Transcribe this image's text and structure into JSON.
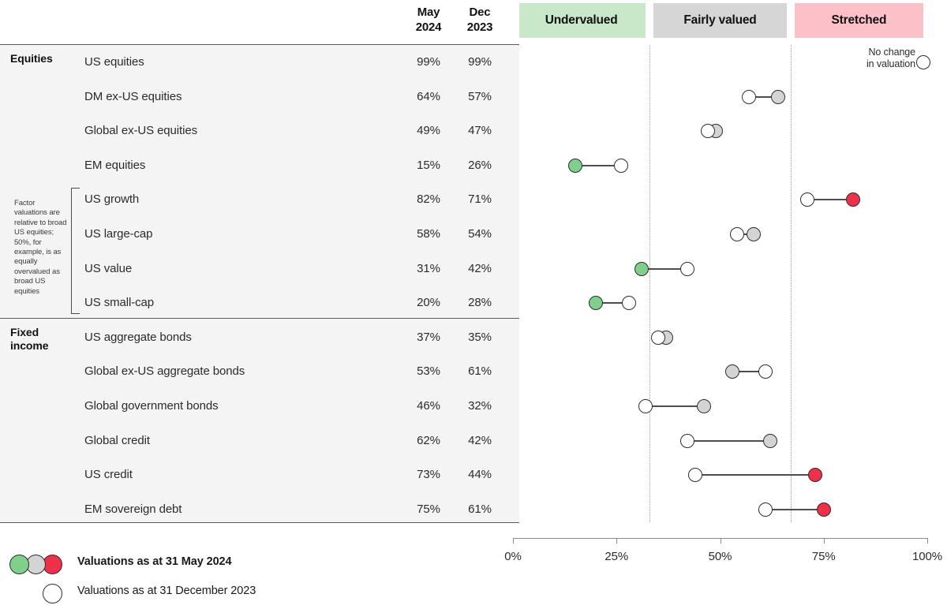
{
  "columns": {
    "may_label_line1": "May",
    "may_label_line2": "2024",
    "dec_label_line1": "Dec",
    "dec_label_line2": "2023"
  },
  "bands": [
    {
      "label": "Undervalued",
      "color": "#c9e8c9",
      "start_pct": 0,
      "end_pct": 33
    },
    {
      "label": "Fairly valued",
      "color": "#d6d6d6",
      "start_pct": 33,
      "end_pct": 67
    },
    {
      "label": "Stretched",
      "color": "#fbc0c8",
      "start_pct": 67,
      "end_pct": 100
    }
  ],
  "groups": [
    {
      "label_line1": "Equities",
      "label_line2": ""
    },
    {
      "label_line1": "Fixed",
      "label_line2": "income"
    }
  ],
  "side_note": "Factor valuations are relative to broad US equities; 50%, for example, is as equally overvalued as broad US equities",
  "annotation": {
    "no_change_line1": "No change",
    "no_change_line2": "in valuation"
  },
  "axis": {
    "ticks": [
      "0%",
      "25%",
      "50%",
      "75%",
      "100%"
    ],
    "tick_values": [
      0,
      25,
      50,
      75,
      100
    ],
    "min": 0,
    "max": 100
  },
  "legend": {
    "current_label": "Valuations as at 31 May 2024",
    "previous_label": "Valuations as at 31 December 2023",
    "current_swatches": [
      "#7ed08a",
      "#d4d4d4",
      "#f03048"
    ],
    "previous_swatch": "#ffffff"
  },
  "colors": {
    "undervalued": "#7ed08a",
    "fairly_valued": "#d4d4d4",
    "stretched": "#f03048",
    "previous": "#ffffff",
    "band_undervalued": "#c9e8c9",
    "band_fairly": "#d6d6d6",
    "band_stretched": "#fbc0c8",
    "table_bg": "#f4f4f4"
  },
  "chart_data": {
    "type": "scatter",
    "title": "",
    "xlabel": "",
    "ylabel": "",
    "xlim": [
      0,
      100
    ],
    "grid": true,
    "gridlines_x": [
      33,
      67
    ],
    "legend_position": "bottom-left",
    "series": [
      {
        "name": "Valuations as at 31 May 2024",
        "key": "may_2024"
      },
      {
        "name": "Valuations as at 31 December 2023",
        "key": "dec_2023"
      }
    ],
    "categories": [
      "US equities",
      "DM ex-US equities",
      "Global ex-US equities",
      "EM equities",
      "US growth",
      "US large-cap",
      "US value",
      "US small-cap",
      "US aggregate bonds",
      "Global ex-US aggregate bonds",
      "Global government bonds",
      "Global credit",
      "US credit",
      "EM sovereign debt"
    ],
    "rows": [
      {
        "group": "Equities",
        "label": "US equities",
        "may_2024": 99,
        "may_2024_text": "99%",
        "dec_2023": 99,
        "dec_2023_text": "99%",
        "may_color": "#ffffff",
        "no_change": true
      },
      {
        "group": "Equities",
        "label": "DM ex-US equities",
        "may_2024": 64,
        "may_2024_text": "64%",
        "dec_2023": 57,
        "dec_2023_text": "57%",
        "may_color": "#d4d4d4",
        "no_change": false
      },
      {
        "group": "Equities",
        "label": "Global ex-US equities",
        "may_2024": 49,
        "may_2024_text": "49%",
        "dec_2023": 47,
        "dec_2023_text": "47%",
        "may_color": "#d4d4d4",
        "no_change": false
      },
      {
        "group": "Equities",
        "label": "EM equities",
        "may_2024": 15,
        "may_2024_text": "15%",
        "dec_2023": 26,
        "dec_2023_text": "26%",
        "may_color": "#7ed08a",
        "no_change": false
      },
      {
        "group": "Equities",
        "label": "US growth",
        "may_2024": 82,
        "may_2024_text": "82%",
        "dec_2023": 71,
        "dec_2023_text": "71%",
        "may_color": "#f03048",
        "no_change": false,
        "factor": true
      },
      {
        "group": "Equities",
        "label": "US large-cap",
        "may_2024": 58,
        "may_2024_text": "58%",
        "dec_2023": 54,
        "dec_2023_text": "54%",
        "may_color": "#d4d4d4",
        "no_change": false,
        "factor": true
      },
      {
        "group": "Equities",
        "label": "US value",
        "may_2024": 31,
        "may_2024_text": "31%",
        "dec_2023": 42,
        "dec_2023_text": "42%",
        "may_color": "#7ed08a",
        "no_change": false,
        "factor": true
      },
      {
        "group": "Equities",
        "label": "US small-cap",
        "may_2024": 20,
        "may_2024_text": "20%",
        "dec_2023": 28,
        "dec_2023_text": "28%",
        "may_color": "#7ed08a",
        "no_change": false,
        "factor": true
      },
      {
        "group": "Fixed income",
        "label": "US aggregate bonds",
        "may_2024": 37,
        "may_2024_text": "37%",
        "dec_2023": 35,
        "dec_2023_text": "35%",
        "may_color": "#d4d4d4",
        "no_change": false
      },
      {
        "group": "Fixed income",
        "label": "Global ex-US aggregate bonds",
        "may_2024": 53,
        "may_2024_text": "53%",
        "dec_2023": 61,
        "dec_2023_text": "61%",
        "may_color": "#d4d4d4",
        "no_change": false
      },
      {
        "group": "Fixed income",
        "label": "Global government bonds",
        "may_2024": 46,
        "may_2024_text": "46%",
        "dec_2023": 32,
        "dec_2023_text": "32%",
        "may_color": "#d4d4d4",
        "no_change": false
      },
      {
        "group": "Fixed income",
        "label": "Global credit",
        "may_2024": 62,
        "may_2024_text": "62%",
        "dec_2023": 42,
        "dec_2023_text": "42%",
        "may_color": "#d4d4d4",
        "no_change": false
      },
      {
        "group": "Fixed income",
        "label": "US credit",
        "may_2024": 73,
        "may_2024_text": "73%",
        "dec_2023": 44,
        "dec_2023_text": "44%",
        "may_color": "#f03048",
        "no_change": false
      },
      {
        "group": "Fixed income",
        "label": "EM sovereign debt",
        "may_2024": 75,
        "may_2024_text": "75%",
        "dec_2023": 61,
        "dec_2023_text": "61%",
        "may_color": "#f03048",
        "no_change": false
      }
    ]
  }
}
